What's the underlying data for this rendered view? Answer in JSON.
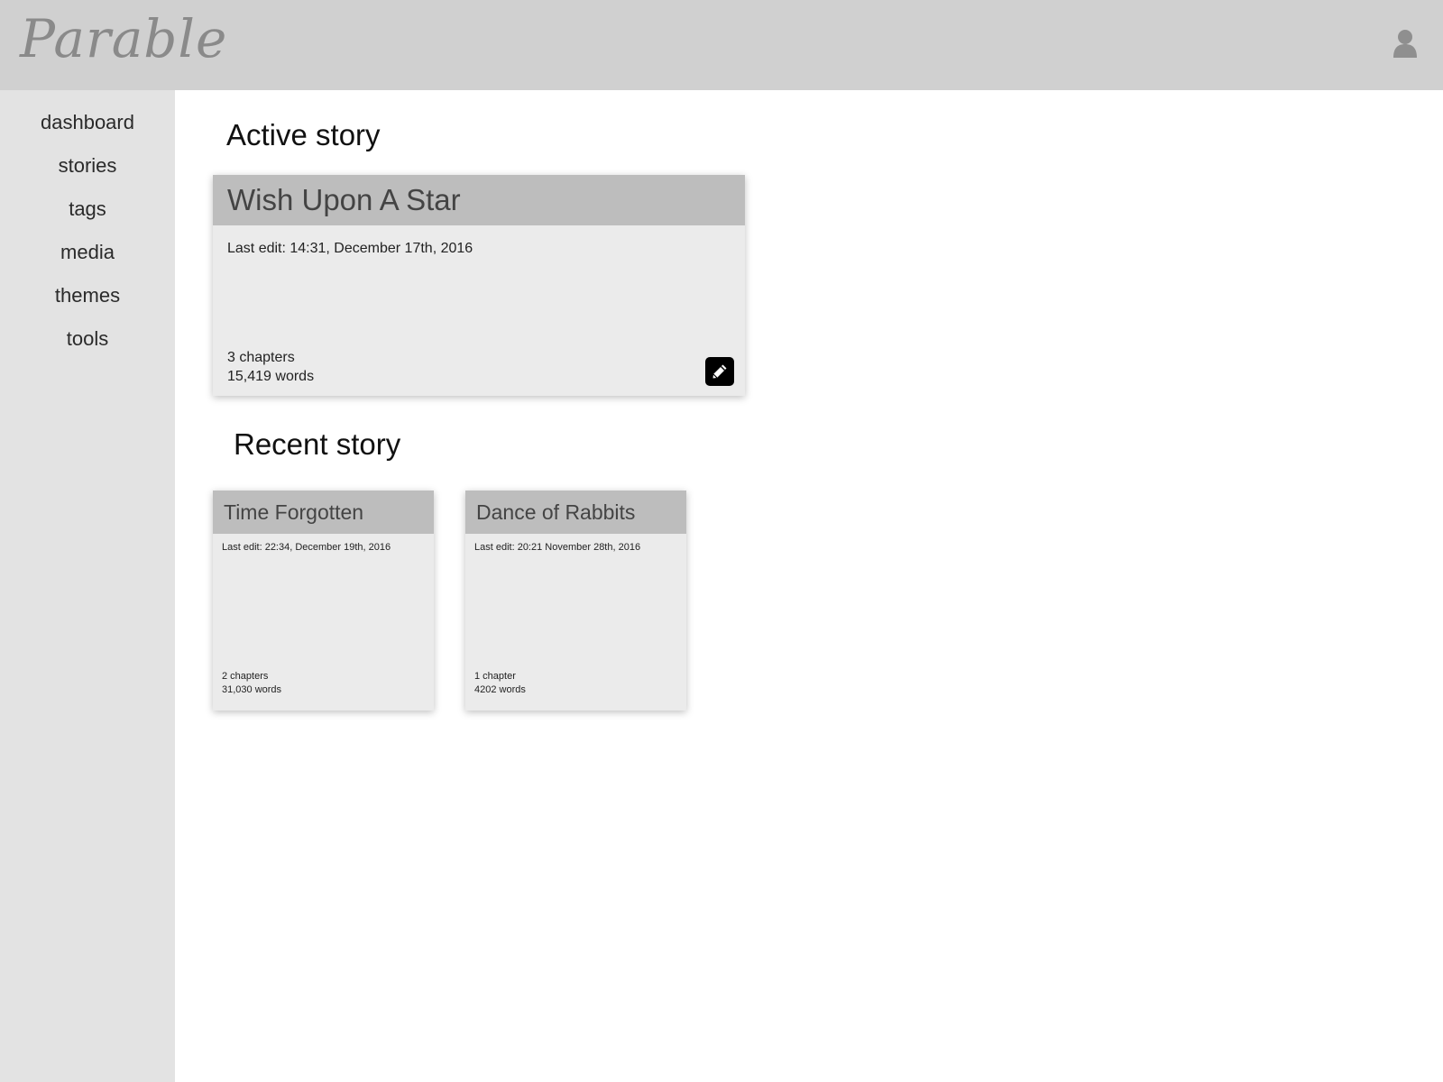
{
  "header": {
    "logo_text": "Parable",
    "user_icon": "user-icon"
  },
  "sidebar": {
    "items": [
      {
        "label": "dashboard"
      },
      {
        "label": "stories"
      },
      {
        "label": "tags"
      },
      {
        "label": "media"
      },
      {
        "label": "themes"
      },
      {
        "label": "tools"
      }
    ]
  },
  "active_section": {
    "title": "Active story",
    "story": {
      "title": "Wish Upon A Star",
      "last_edit": "Last edit: 14:31, December 17th, 2016",
      "chapters": "3 chapters",
      "words": "15,419 words",
      "edit_icon": "pencil-icon"
    }
  },
  "recent_section": {
    "title": "Recent story",
    "stories": [
      {
        "title": "Time Forgotten",
        "last_edit": "Last edit: 22:34, December 19th, 2016",
        "chapters": "2 chapters",
        "words": "31,030 words"
      },
      {
        "title": "Dance of Rabbits",
        "last_edit": "Last edit: 20:21 November 28th, 2016",
        "chapters": "1 chapter",
        "words": "4202 words"
      }
    ]
  }
}
